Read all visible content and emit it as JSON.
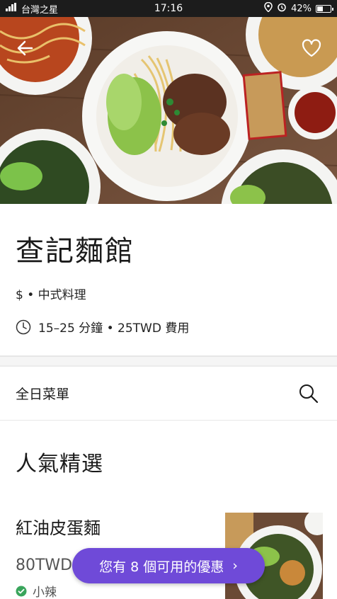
{
  "status_bar": {
    "carrier": "台灣之星",
    "time": "17:16",
    "battery": "42%",
    "battery_level": 0.42
  },
  "store": {
    "name": "查記麵館",
    "meta": "$ • 中式料理",
    "delivery": "15–25 分鐘 • 25TWD 費用"
  },
  "menu": {
    "label": "全日菜單"
  },
  "section": {
    "title": "人氣精選"
  },
  "item": {
    "name": "紅油皮蛋麵",
    "price": "80TWD",
    "tag": "小辣"
  },
  "promo": {
    "label": "您有 8 個可用的優惠",
    "chevron": "›"
  },
  "icons": {
    "back": "arrow-left-icon",
    "favorite": "heart-outline-icon",
    "clock": "clock-icon",
    "search": "search-icon",
    "tag": "check-badge-icon"
  },
  "colors": {
    "promo": "#6f4ad8",
    "tag_badge": "#3aa55c"
  }
}
